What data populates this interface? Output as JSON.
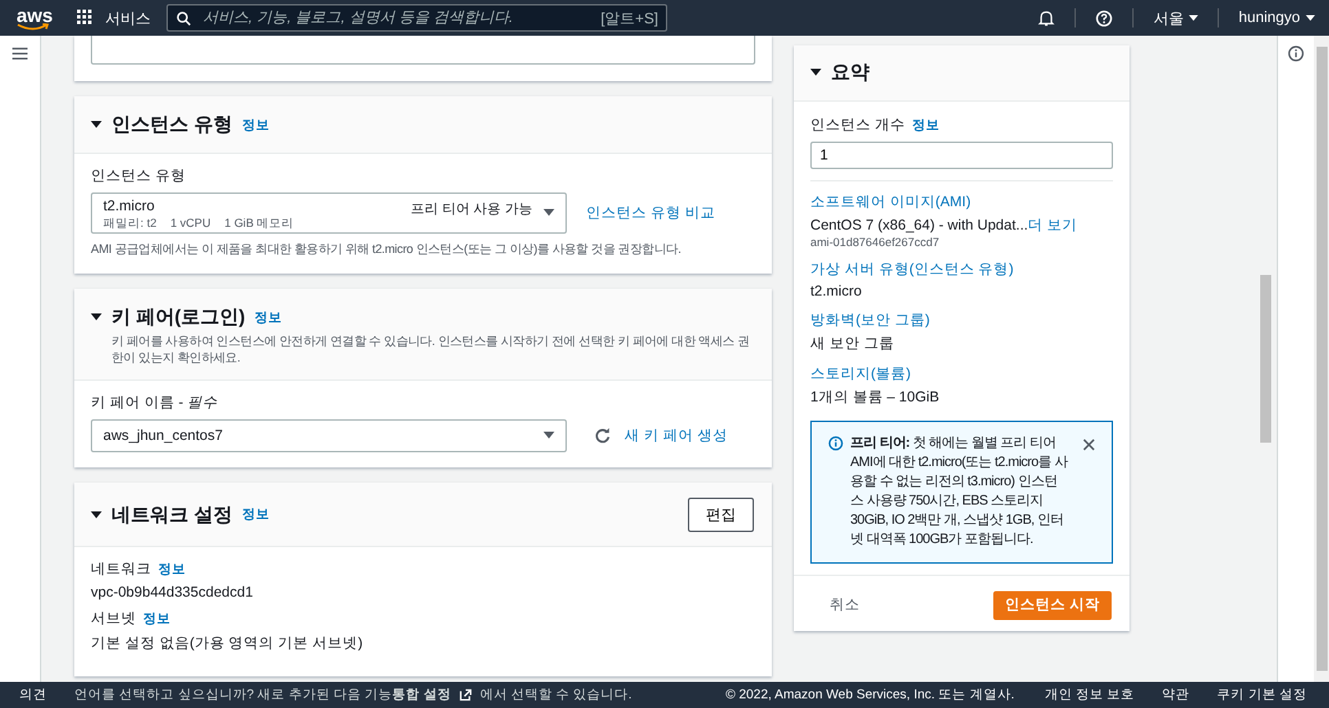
{
  "nav": {
    "logo": "aws",
    "services": "서비스",
    "search": {
      "placeholder": "서비스, 기능, 블로그, 설명서 등을 검색합니다.",
      "shortcut": "[알트+S]"
    },
    "region": "서울",
    "user": "huningyo"
  },
  "sections": [
    {
      "kind": "instance_type",
      "title": "인스턴스 유형",
      "info": "정보",
      "expanded": true,
      "field_label": "인스턴스 유형",
      "select": {
        "value": "t2.micro",
        "details": [
          "패밀리: t2",
          "1 vCPU",
          "1 GiB 메모리"
        ],
        "badge": "프리 티어 사용 가능"
      },
      "link": "인스턴스 유형 비교",
      "hint": "AMI 공급업체에서는 이 제품을 최대한 활용하기 위해 t2.micro 인스턴스(또는 그 이상)를 사용할 것을 권장합니다."
    },
    {
      "kind": "key_pair",
      "title": "키 페어(로그인)",
      "info": "정보",
      "expanded": true,
      "description": "키 페어를 사용하여 인스턴스에 안전하게 연결할 수 있습니다. 인스턴스를 시작하기 전에 선택한 키 페어에 대한 액세스 권한이 있는지 확인하세요.",
      "field_label": "키 페어 이름 - *필수*",
      "select": {
        "value": "aws_jhun_centos7"
      },
      "link": "새 키 페어 생성"
    },
    {
      "kind": "network",
      "title": "네트워크 설정",
      "info": "정보",
      "expanded": true,
      "button": "편집",
      "fields": [
        {
          "label": "네트워크",
          "info": "정보",
          "value": "vpc-0b9b44d335cdedcd1"
        },
        {
          "label": "서브넷",
          "info": "정보",
          "value": "기본 설정 없음(가용 영역의 기본 서브넷)"
        }
      ]
    }
  ],
  "summary": {
    "title": "요약",
    "expanded": true,
    "count_label": "인스턴스 개수",
    "count_info": "정보",
    "count_value": "1",
    "items": [
      {
        "heading": "소프트웨어 이미지(AMI)",
        "value": "CentOS 7 (x86_64) - with Updat...",
        "more": "더 보기",
        "sub": "ami-01d87646ef267ccd7"
      },
      {
        "heading": "가상 서버 유형(인스턴스 유형)",
        "value": "t2.micro"
      },
      {
        "heading": "방화벽(보안 그룹)",
        "value": "새 보안 그룹"
      },
      {
        "heading": "스토리지(볼륨)",
        "value": "1개의 볼륨 – 10GiB"
      }
    ],
    "alert": "**프리 티어:** 첫 해에는 월별 프리 티어 AMI에 대한 t2.micro(또는 t2.micro를 사용할 수 없는 리전의 t3.micro) 인스턴스 사용량 750시간, EBS 스토리지 30GiB, IO 2백만 개, 스냅샷 1GB, 인터넷 대역폭 100GB가 포함됩니다.",
    "cancel": "취소",
    "launch": "인스턴스 시작"
  },
  "footer": {
    "feedback": "의견",
    "notice_before": "언어를 선택하고 싶으십니까? 새로 추가된 다음 기능**통합 설정**",
    "notice_after": "에서 선택할 수 있습니다.",
    "copyright": "© 2022, Amazon Web Services, Inc. 또는 계열사.",
    "links": [
      "개인 정보 보호",
      "약관",
      "쿠키 기본 설정"
    ]
  }
}
